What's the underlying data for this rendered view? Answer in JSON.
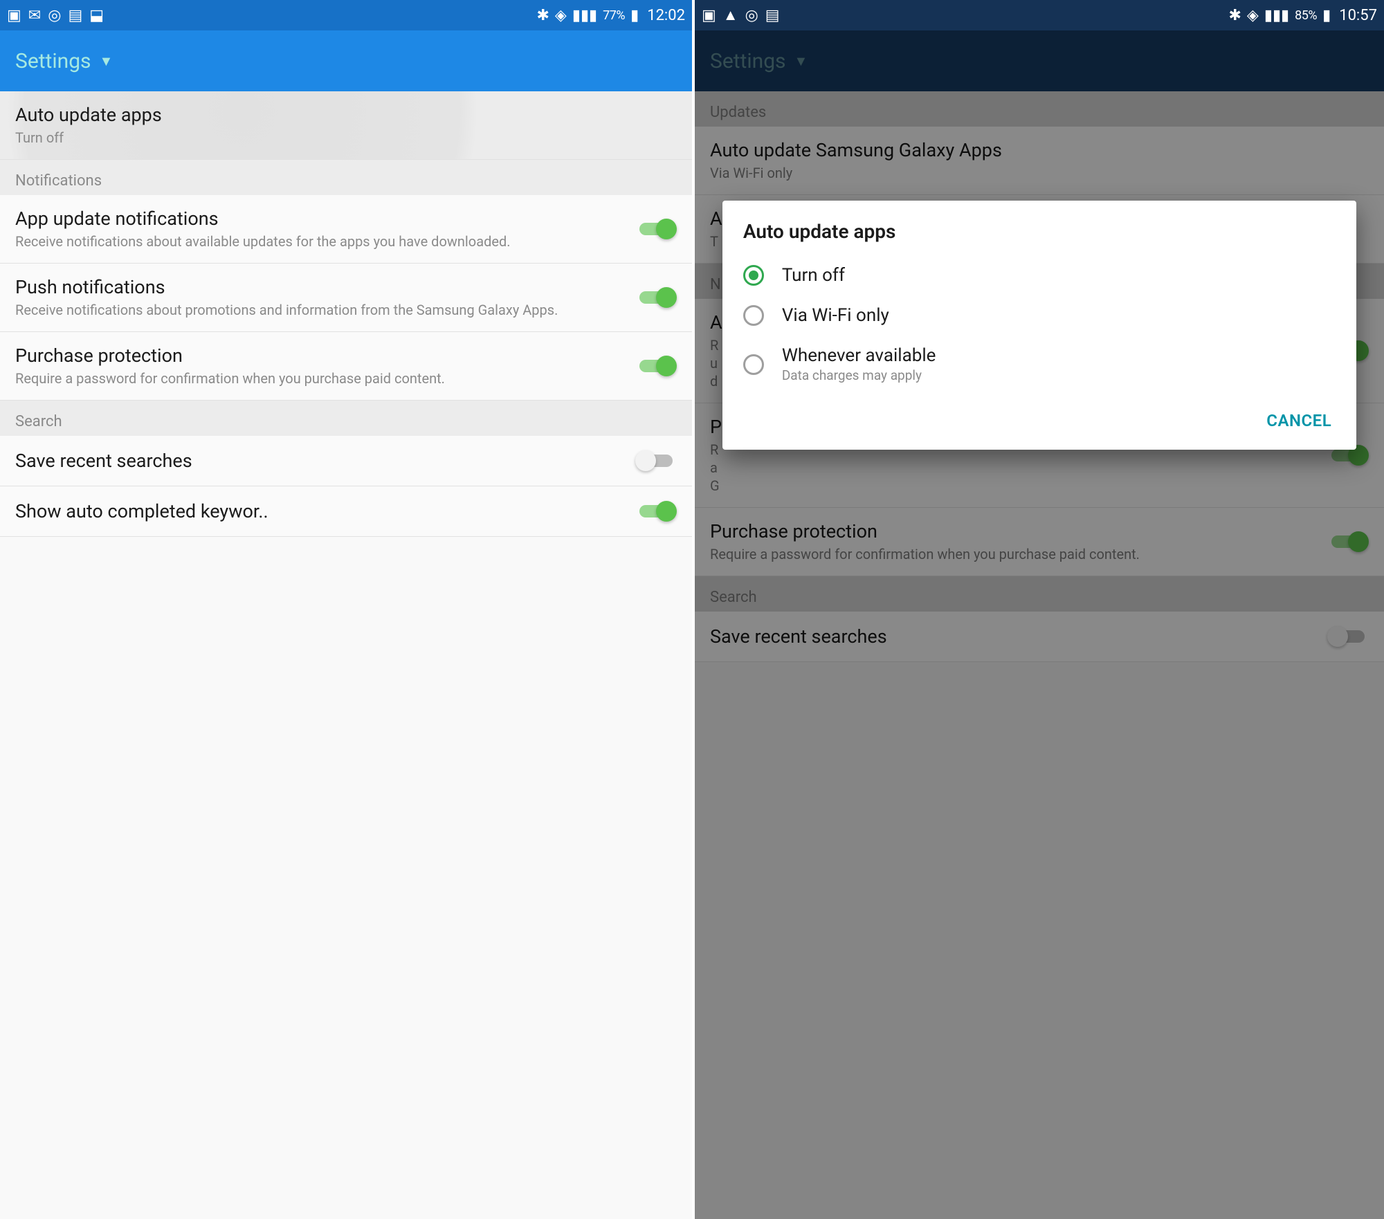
{
  "left": {
    "statusbar": {
      "battery_pct": "77%",
      "time": "12:02"
    },
    "appbar": {
      "title": "Settings"
    },
    "rows": {
      "auto_update": {
        "title": "Auto update apps",
        "sub": "Turn off"
      },
      "sec_notifications": "Notifications",
      "app_upd_notif": {
        "title": "App update notifications",
        "sub": "Receive notifications about available updates for the apps you have downloaded."
      },
      "push_notif": {
        "title": "Push notifications",
        "sub": "Receive notifications about promotions and information from the Samsung Galaxy Apps."
      },
      "purchase_prot": {
        "title": "Purchase protection",
        "sub": "Require a password for confirmation when you purchase paid content."
      },
      "sec_search": "Search",
      "save_recent": {
        "title": "Save recent searches"
      },
      "auto_complete": {
        "title": "Show auto completed keywor.."
      }
    }
  },
  "right": {
    "statusbar": {
      "battery_pct": "85%",
      "time": "10:57"
    },
    "appbar": {
      "title": "Settings"
    },
    "rows": {
      "sec_updates": "Updates",
      "auto_update_sga": {
        "title": "Auto update Samsung Galaxy Apps",
        "sub": "Via Wi-Fi only"
      },
      "auto_update": {
        "title": "A",
        "sub": "T"
      },
      "sec_notifications": "N",
      "app_upd_notif": {
        "title": "A",
        "sub": "R\nu\nd"
      },
      "push_notif": {
        "title": "P",
        "sub": "R\na\nG"
      },
      "purchase_prot": {
        "title": "Purchase protection",
        "sub": "Require a password for confirmation when you purchase paid content."
      },
      "sec_search": "Search",
      "save_recent": {
        "title": "Save recent searches"
      }
    },
    "dialog": {
      "title": "Auto update apps",
      "options": [
        {
          "label": "Turn off",
          "sub": ""
        },
        {
          "label": "Via Wi-Fi only",
          "sub": ""
        },
        {
          "label": "Whenever available",
          "sub": "Data charges may apply"
        }
      ],
      "selected_index": 0,
      "cancel": "CANCEL"
    }
  }
}
